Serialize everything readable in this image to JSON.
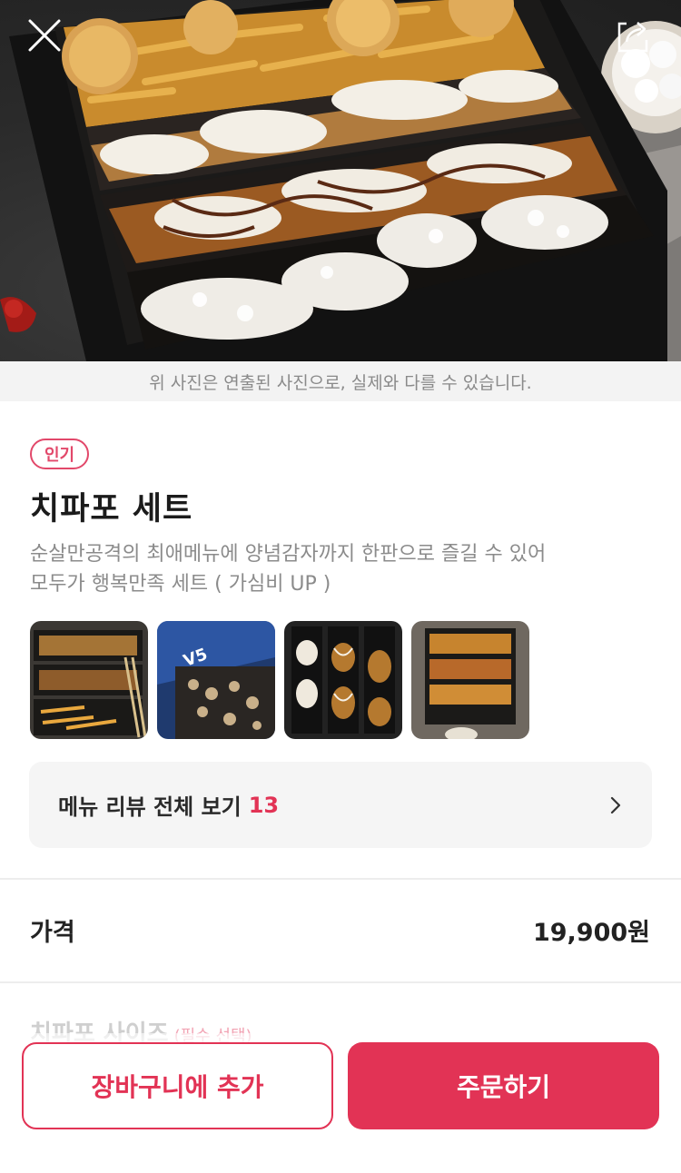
{
  "hero": {
    "photo_note": "위 사진은 연출된 사진으로, 실제와 다를 수 있습니다.",
    "close_icon": "close-icon",
    "share_icon": "share-icon"
  },
  "menu": {
    "badge": "인기",
    "title": "치파포 세트",
    "description_line1": "순살만공격의 최애메뉴에 양념감자까지 한판으로 즐길 수 있어",
    "description_line2": "모두가 행복만족 세트 ( 가심비 UP )"
  },
  "reviews": {
    "label": "메뉴 리뷰 전체 보기",
    "count": "13"
  },
  "price": {
    "label": "가격",
    "value": "19,900원"
  },
  "options": {
    "size_label": "치파포 사이즈",
    "size_required": "(필수 선택)"
  },
  "actions": {
    "add_to_cart": "장바구니에 추가",
    "order": "주문하기"
  },
  "colors": {
    "accent": "#e23355",
    "badge": "#e2486a"
  }
}
